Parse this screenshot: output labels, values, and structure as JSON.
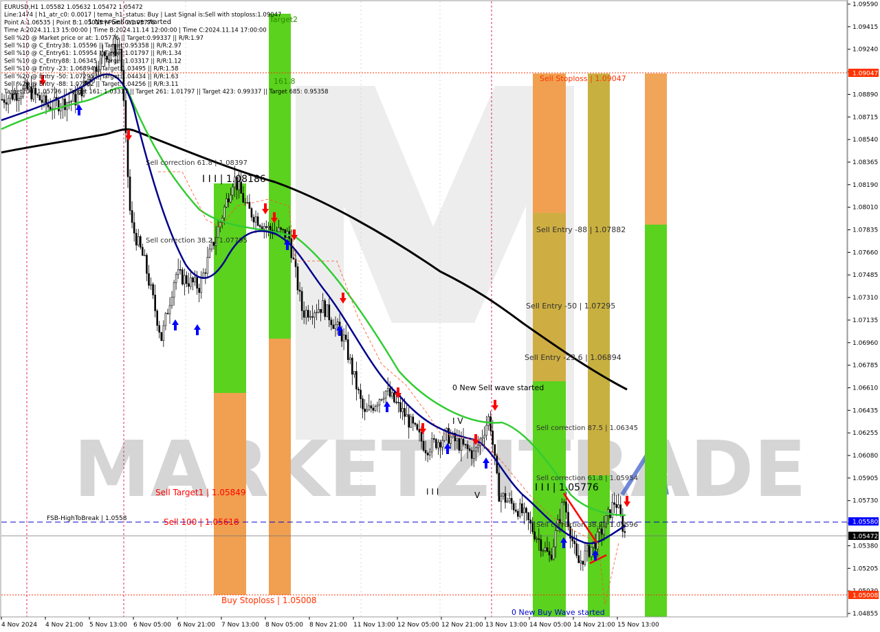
{
  "info_lines": [
    "EURUSD,H1  1.05582 1.05632 1.05472 1.05472",
    "Line:1474 | h1_atr_c0: 0.0017 | tema_h1_status: Buy | Last Signal is:Sell with stoploss:1.09047",
    "Point A:1.06535 | Point B:1.05015 | Point C:1.05776",
    "Time A:2024.11.13 15:00:00 | Time B:2024.11.14 12:00:00 | Time C:2024.11.14 17:00:00",
    "Sell %20 @ Market price or at: 1.05776 || Target:0.99337 || R/R:1.97",
    "Sell %10 @ C_Entry38: 1.05596 || Target:0.95358 || R/R:2.97",
    "Sell %10 @ C_Entry61: 1.05954 || Target:1.01797 || R/R:1.34",
    "Sell %10 @ C_Entry88: 1.06345 || Target:1.03317 || R/R:1.12",
    "Sell %10 @ Entry -23: 1.06894 || Target:1.03495 || R/R:1.58",
    "Sell %20 @ Entry -50: 1.07295 || Target:1.04434 || R/R:1.63",
    "Sell %20 @ Entry -88: 1.07882 || Target:1.04256 || R/R:3.11",
    "Target100: 1.05776 || Target 161: 1.03317 || Target 261: 1.01797 || Target 423: 0.99337 || Target 685: 0.95358"
  ],
  "watermark": "MARKETZITRADE",
  "price_scale": {
    "ticks": [
      "1.09590",
      "1.09415",
      "1.09240",
      "1.09065",
      "1.08890",
      "1.08715",
      "1.08540",
      "1.08365",
      "1.08190",
      "1.08010",
      "1.07835",
      "1.07660",
      "1.07485",
      "1.07310",
      "1.07135",
      "1.06960",
      "1.06785",
      "1.06610",
      "1.06435",
      "1.06255",
      "1.06080",
      "1.05905",
      "1.05730",
      "1.05555",
      "1.05380",
      "1.05205",
      "1.05030",
      "1.04855"
    ],
    "marks": [
      {
        "text": "1.09047",
        "color": "#ff3300"
      },
      {
        "text": "1.05580",
        "color": "#0000ff"
      },
      {
        "text": "1.05472",
        "color": "#000000"
      },
      {
        "text": "1.05008",
        "color": "#ff3300"
      }
    ]
  },
  "time_labels": [
    "4 Nov 2024",
    "4 Nov 21:00",
    "5 Nov 13:00",
    "6 Nov 05:00",
    "6 Nov 21:00",
    "7 Nov 13:00",
    "8 Nov 05:00",
    "8 Nov 21:00",
    "11 Nov 13:00",
    "12 Nov 05:00",
    "12 Nov 21:00",
    "13 Nov 13:00",
    "14 Nov 05:00",
    "14 Nov 21:00",
    "15 Nov 13:00"
  ],
  "labels": {
    "sell_stoploss": "Sell Stoploss | 1.09047",
    "sell_entry_88": "Sell Entry -88 | 1.07882",
    "sell_entry_50": "Sell Entry -50 | 1.07295",
    "sell_entry_23": "Sell Entry -23.6 | 1.06894",
    "sell_corr_875": "Sell correction 87.5 | 1.06345",
    "sell_corr_618_right": "Sell correction 61.8 | 1.05954",
    "sell_corr_382_right": "Sell correction 38.2 | 1.05596",
    "point_c": "I I I | 1.05776",
    "new_sell_wave_13": "0 New Sell wave started",
    "new_buy_wave": "0 New Buy Wave started",
    "sell_target1": "Sell Target1 | 1.05849",
    "sell_100": "Sell 100 | 1.05618",
    "fsb": "FSB-HighToBreak | 1.0558",
    "buy_stoploss": "Buy Stoploss | 1.05008",
    "sell_corr_618_left": "Sell correction 61.8 | 1.08397",
    "sell_corr_382_left": "Sell correction 38.2 | 1.07795",
    "point_1_08186": "I I I | 1.08186",
    "new_sell_wave_top": "1 New Sell wave started",
    "target2": "Target2",
    "t161": "161.8",
    "wave_iv": "I V",
    "wave_iii": "I I I",
    "wave_v": "V"
  },
  "colors": {
    "green_zone": "#5ad21e",
    "orange_zone": "#f0a050",
    "olive_zone": "#c8b040",
    "ma_black": "#000000",
    "ma_navy": "#00008b",
    "ma_green": "#33cc33",
    "red_arrow": "#ff0000",
    "blue_arrow": "#0000ff",
    "stop_line": "#ff3300",
    "fsb_line": "#0000cc"
  },
  "chart_data": {
    "type": "candlestick",
    "symbol": "EURUSD",
    "timeframe": "H1",
    "ohlc_last": {
      "open": 1.05582,
      "high": 1.05632,
      "low": 1.05472,
      "close": 1.05472
    },
    "ylim": [
      1.04855,
      1.0959
    ],
    "x": [
      "4 Nov 2024",
      "4 Nov 21:00",
      "5 Nov 13:00",
      "6 Nov 05:00",
      "6 Nov 21:00",
      "7 Nov 13:00",
      "8 Nov 05:00",
      "8 Nov 21:00",
      "11 Nov 13:00",
      "12 Nov 05:00",
      "12 Nov 21:00",
      "13 Nov 13:00",
      "14 Nov 05:00",
      "14 Nov 21:00",
      "15 Nov 13:00"
    ],
    "close_approx": [
      1.0885,
      1.088,
      1.089,
      1.094,
      1.079,
      1.074,
      1.078,
      1.082,
      1.078,
      1.072,
      1.066,
      1.063,
      1.061,
      1.055,
      1.0547
    ],
    "levels": [
      {
        "name": "Sell Stoploss",
        "value": 1.09047
      },
      {
        "name": "Sell Entry -88",
        "value": 1.07882
      },
      {
        "name": "Sell Entry -50",
        "value": 1.07295
      },
      {
        "name": "Sell Entry -23.6",
        "value": 1.06894
      },
      {
        "name": "Sell correction 87.5",
        "value": 1.06345
      },
      {
        "name": "Sell correction 61.8",
        "value": 1.05954
      },
      {
        "name": "Sell Target1",
        "value": 1.05849
      },
      {
        "name": "Point C",
        "value": 1.05776
      },
      {
        "name": "Sell 100",
        "value": 1.05618
      },
      {
        "name": "Sell correction 38.2",
        "value": 1.05596
      },
      {
        "name": "FSB-HighToBreak",
        "value": 1.0558
      },
      {
        "name": "Buy Stoploss",
        "value": 1.05008
      }
    ]
  }
}
